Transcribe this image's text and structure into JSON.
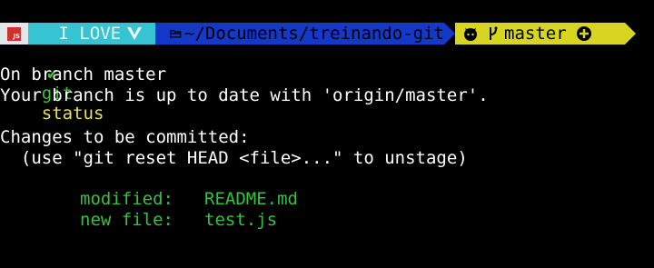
{
  "prompt": {
    "logo_text": "JS",
    "love_text": " I LOVE",
    "path_text": "~/Documents/treinando-git",
    "branch_text": "master"
  },
  "command": {
    "git": "git",
    "args": "status"
  },
  "output": {
    "line1": "On branch master",
    "line2": "Your branch is up to date with 'origin/master'.",
    "line3": "Changes to be committed:",
    "line4": "  (use \"git reset HEAD <file>...\" to unstage)",
    "modified_label": "modified:",
    "modified_file": "README.md",
    "new_label": "new file:",
    "new_file": "test.js"
  },
  "colors": {
    "background": "#000000",
    "love_segment": "#36c3d2",
    "path_segment": "#1438c8",
    "git_segment": "#d7d51f",
    "staged_text": "#34c33a"
  }
}
